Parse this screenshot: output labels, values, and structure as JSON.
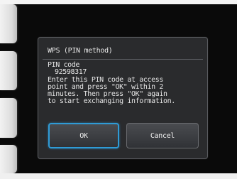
{
  "dialog": {
    "title": "WPS (PIN method)",
    "pin_label": "PIN code",
    "pin_code": "92598317",
    "message": "Enter this PIN code at access\npoint and press \"OK\" within 2\nminutes. Then press \"OK\" again\nto start exchanging information.",
    "ok_label": "OK",
    "cancel_label": "Cancel"
  },
  "colors": {
    "focus_accent": "#2f9bd6",
    "dialog_bg": "#2a2b2d",
    "screen_bg": "#0a0a0a"
  }
}
